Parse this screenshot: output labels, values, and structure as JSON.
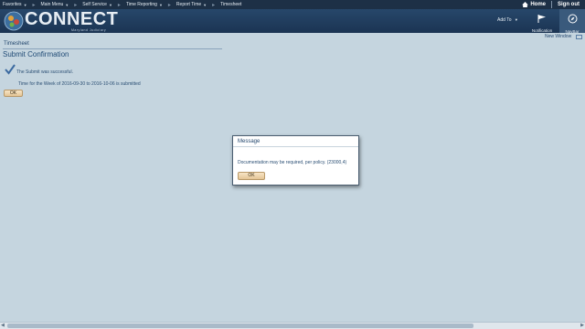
{
  "menu": {
    "items": [
      {
        "label": "Favorites",
        "caret": true
      },
      {
        "label": "Main Menu",
        "caret": true
      },
      {
        "label": "Self Service",
        "caret": true
      },
      {
        "label": "Time Reporting",
        "caret": true
      },
      {
        "label": "Report Time",
        "caret": true
      },
      {
        "label": "Timesheet",
        "caret": false
      }
    ],
    "home_label": "Home",
    "signout_label": "Sign out"
  },
  "banner": {
    "logo_text": "CONNECT",
    "logo_subtitle": "Maryland Judiciary",
    "add_to_label": "Add To",
    "notification_label": "Notification",
    "navbar_label": "NavBar"
  },
  "subheader": {
    "new_window_label": "New Window"
  },
  "page": {
    "breadcrumb": "Timesheet",
    "title": "Submit Confirmation",
    "success_text": "The Submit was successful.",
    "detail_text": "Time for the Week of 2016-09-30 to  2016-10-06 is submitted",
    "ok_label": "OK"
  },
  "modal": {
    "title": "Message",
    "message": "Documentation may be required, per policy.  (23000,4)",
    "ok_label": "OK"
  },
  "colors": {
    "menubar": "#1d3046",
    "banner": "#27476a",
    "page_bg": "#c5d5df",
    "button": "#e4c596"
  }
}
